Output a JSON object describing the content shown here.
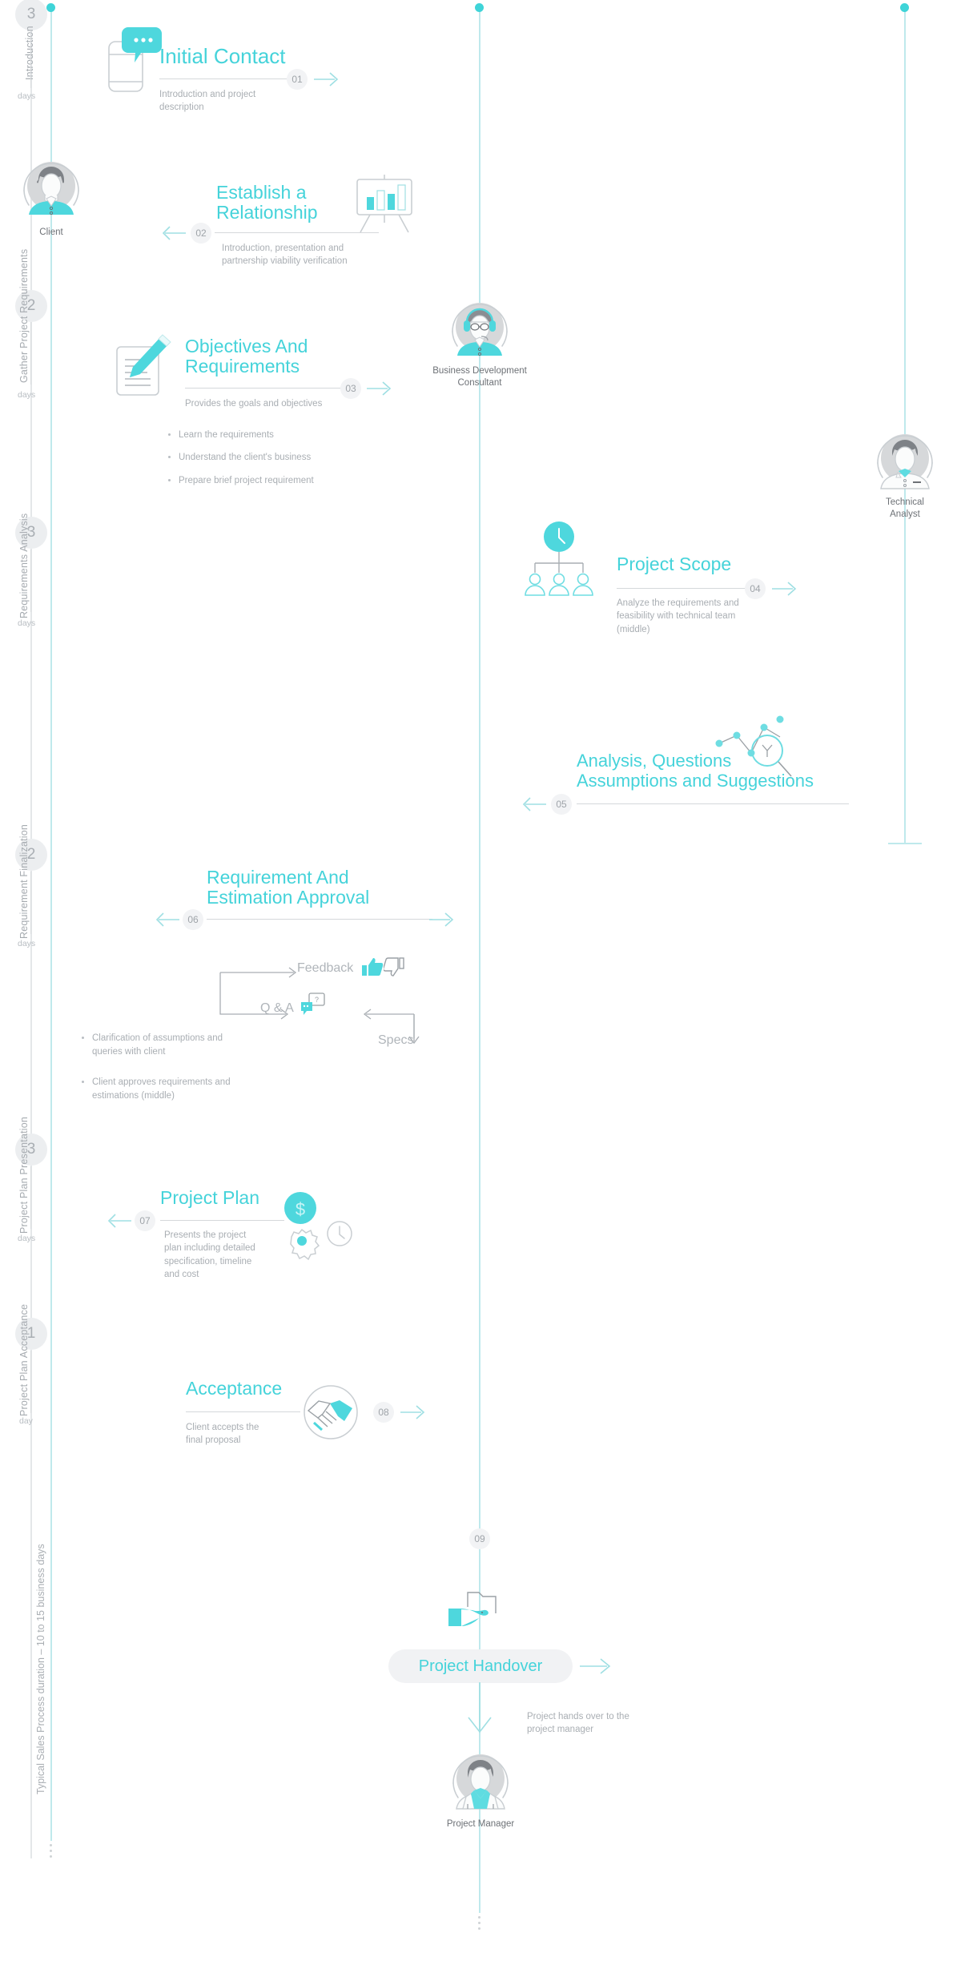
{
  "meta": {
    "accent": "#45d3da",
    "accent_dark": "#3fd4d8",
    "muted": "#a9aeb3",
    "rail": "#bfe9ec"
  },
  "phases": [
    {
      "badge": "3",
      "label": "Introduction",
      "unit": "days"
    },
    {
      "badge": "2",
      "label": "Gather Project\nRequirements",
      "unit": "days"
    },
    {
      "badge": "3",
      "label": "Requirements\nAnalysis",
      "unit": "days"
    },
    {
      "badge": "2",
      "label": "Requirement\nFinalization",
      "unit": "days"
    },
    {
      "badge": "3",
      "label": "Project Plan\nPresentation",
      "unit": "days"
    },
    {
      "badge": "1",
      "label": "Project Plan\nAcceptance",
      "unit": "day"
    }
  ],
  "duration_note": "Typical Sales Process duration – 10 to 15 business days",
  "steps": [
    {
      "num": "01",
      "title": "Initial Contact",
      "desc": "Introduction and project\ndescription",
      "icon": "mobile-chat-icon"
    },
    {
      "num": "02",
      "title": "Establish a\nRelationship",
      "desc": "Introduction, presentation and\npartnership viability verification",
      "icon": "presentation-board-icon"
    },
    {
      "num": "03",
      "title": "Objectives And\nRequirements",
      "desc": "Provides the goals and objectives",
      "icon": "document-pencil-icon",
      "bullets": [
        "Learn the requirements",
        "Understand the client's business",
        "Prepare brief project requirement"
      ]
    },
    {
      "num": "04",
      "title": "Project Scope",
      "desc": "Analyze the requirements and\nfeasibility with technical team\n(middle)",
      "icon": "team-hierarchy-clock-icon"
    },
    {
      "num": "05",
      "title": "Analysis, Questions\nAssumptions and Suggestions",
      "desc": "",
      "icon": "chart-magnifier-icon"
    },
    {
      "num": "06",
      "title": "Requirement And\nEstimation Approval",
      "desc": "",
      "icon": "feedback-loop-icon",
      "loop": {
        "feedback": "Feedback",
        "qa": "Q & A",
        "specs": "Specs"
      },
      "bullets": [
        "Clarification of assumptions and\nqueries with client",
        "Client approves requirements and\nestimations (middle)"
      ]
    },
    {
      "num": "07",
      "title": "Project Plan",
      "desc": "Presents the project\nplan including detailed\nspecification, timeline\nand cost",
      "icon": "dollar-gear-clock-icon"
    },
    {
      "num": "08",
      "title": "Acceptance",
      "desc": "Client accepts the\nfinal proposal",
      "icon": "handshake-icon"
    },
    {
      "num": "09",
      "title": "Project Handover",
      "desc": "Project hands over to the\nproject manager",
      "icon": "hand-folder-icon"
    }
  ],
  "actors": [
    {
      "id": "client",
      "label": "Client"
    },
    {
      "id": "bdc",
      "label": "Business Development\nConsultant"
    },
    {
      "id": "analyst",
      "label": "Technical\nAnalyst"
    },
    {
      "id": "pm",
      "label": "Project Manager"
    }
  ]
}
